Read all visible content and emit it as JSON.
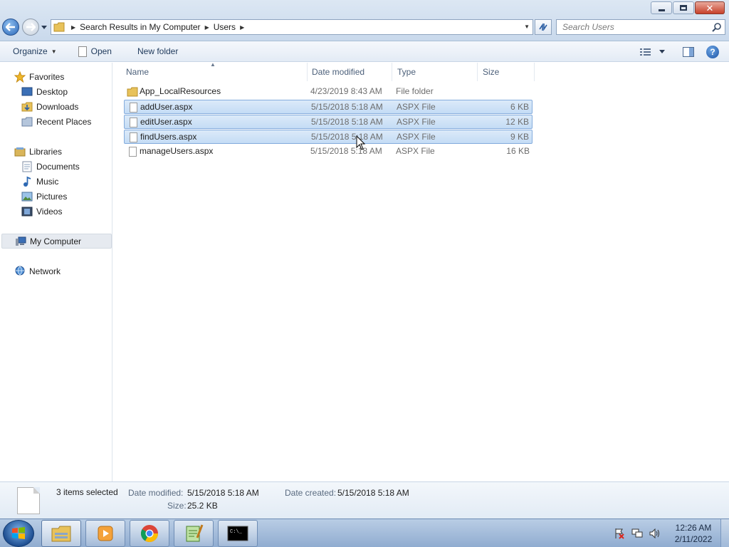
{
  "window": {
    "breadcrumb": [
      "Search Results in My Computer",
      "Users"
    ],
    "search_placeholder": "Search Users"
  },
  "toolbar": {
    "organize_label": "Organize",
    "open_label": "Open",
    "new_folder_label": "New folder"
  },
  "nav": {
    "favorites": "Favorites",
    "desktop": "Desktop",
    "downloads": "Downloads",
    "recent_places": "Recent Places",
    "libraries": "Libraries",
    "documents": "Documents",
    "music": "Music",
    "pictures": "Pictures",
    "videos": "Videos",
    "my_computer": "My Computer",
    "network": "Network"
  },
  "columns": {
    "name": "Name",
    "date_modified": "Date modified",
    "type": "Type",
    "size": "Size"
  },
  "files": [
    {
      "name": "App_LocalResources",
      "date": "4/23/2019 8:43 AM",
      "type": "File folder",
      "size": "",
      "icon": "folder-icon",
      "selected": false
    },
    {
      "name": "addUser.aspx",
      "date": "5/15/2018 5:18 AM",
      "type": "ASPX File",
      "size": "6 KB",
      "icon": "document-icon",
      "selected": true
    },
    {
      "name": "editUser.aspx",
      "date": "5/15/2018 5:18 AM",
      "type": "ASPX File",
      "size": "12 KB",
      "icon": "document-icon",
      "selected": true
    },
    {
      "name": "findUsers.aspx",
      "date": "5/15/2018 5:18 AM",
      "type": "ASPX File",
      "size": "9 KB",
      "icon": "document-icon",
      "selected": true
    },
    {
      "name": "manageUsers.aspx",
      "date": "5/15/2018 5:18 AM",
      "type": "ASPX File",
      "size": "16 KB",
      "icon": "document-icon",
      "selected": false
    }
  ],
  "details": {
    "selection": "3 items selected",
    "date_modified_label": "Date modified:",
    "date_modified_value": "5/15/2018 5:18 AM",
    "date_created_label": "Date created:",
    "date_created_value": "5/15/2018 5:18 AM",
    "size_label": "Size:",
    "size_value": "25.2 KB"
  },
  "taskbar": {
    "apps": [
      "explorer-icon",
      "media-player-icon",
      "chrome-icon",
      "notepad-plus-plus-icon",
      "command-prompt-icon"
    ],
    "clock_time": "12:26 AM",
    "clock_date": "2/11/2022"
  },
  "colors": {
    "selection_fill": "#cce1f7",
    "selection_border": "#84acdd",
    "accent": "#1e395b"
  }
}
